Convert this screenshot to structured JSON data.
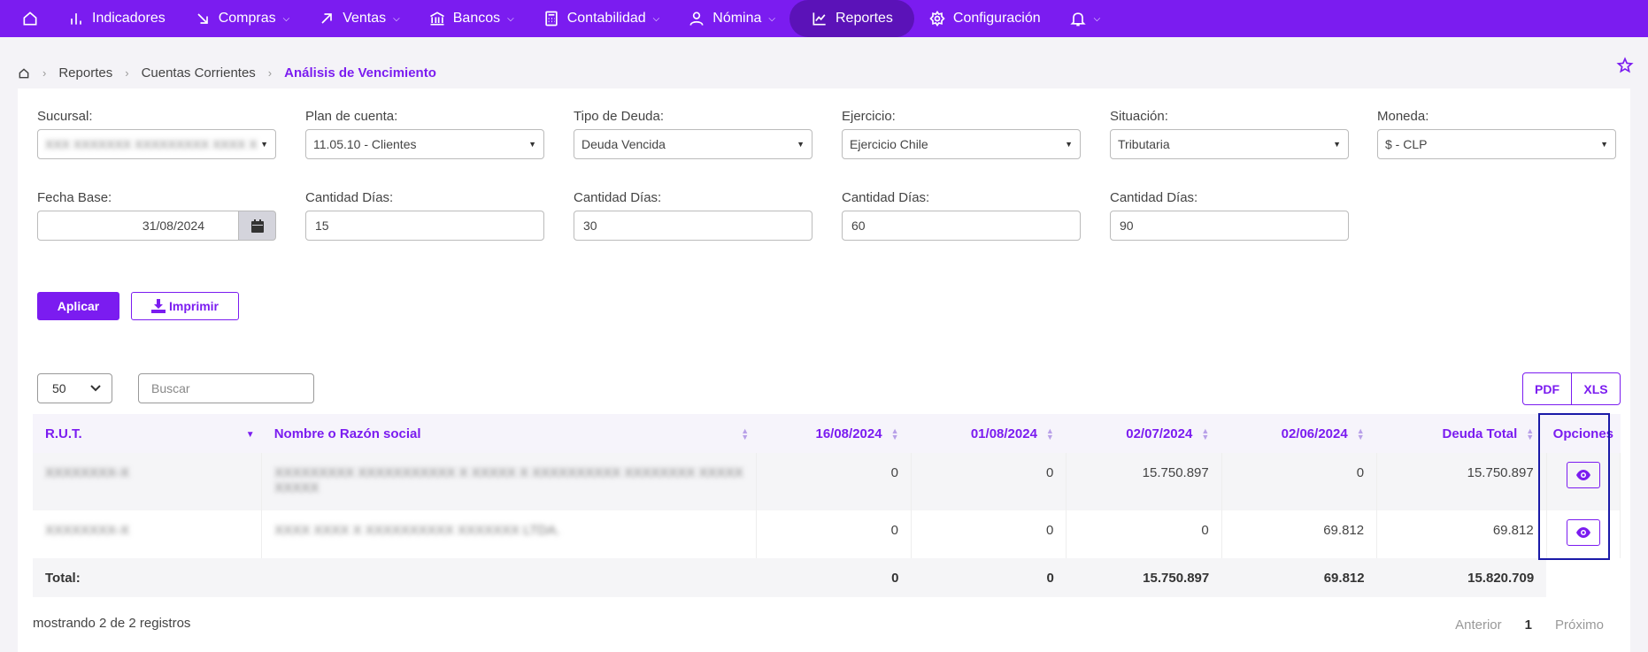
{
  "nav": {
    "items": [
      {
        "label": "",
        "icon": "home-icon"
      },
      {
        "label": "Indicadores",
        "icon": "bar-chart-icon"
      },
      {
        "label": "Compras",
        "icon": "arrow-down-right-icon"
      },
      {
        "label": "Ventas",
        "icon": "arrow-up-right-icon"
      },
      {
        "label": "Bancos",
        "icon": "bank-icon"
      },
      {
        "label": "Contabilidad",
        "icon": "calculator-icon"
      },
      {
        "label": "Nómina",
        "icon": "user-icon"
      },
      {
        "label": "Reportes",
        "icon": "line-chart-icon"
      },
      {
        "label": "Configuración",
        "icon": "gear-icon"
      },
      {
        "label": "",
        "icon": "bell-icon"
      }
    ]
  },
  "breadcrumb": {
    "item1": "Reportes",
    "item2": "Cuentas Corrientes",
    "current": "Análisis de Vencimiento"
  },
  "filters": {
    "sucursal": {
      "label": "Sucursal:",
      "value": "XXX XXXXXXX XXXXXXXXX XXXX X"
    },
    "plan": {
      "label": "Plan de cuenta:",
      "value": "11.05.10 - Clientes"
    },
    "tipo": {
      "label": "Tipo de Deuda:",
      "value": "Deuda Vencida"
    },
    "ejercicio": {
      "label": "Ejercicio:",
      "value": "Ejercicio Chile"
    },
    "situacion": {
      "label": "Situación:",
      "value": "Tributaria"
    },
    "moneda": {
      "label": "Moneda:",
      "value": "$ - CLP"
    },
    "fecha": {
      "label": "Fecha Base:",
      "value": "31/08/2024"
    },
    "dias1": {
      "label": "Cantidad Días:",
      "value": "15"
    },
    "dias2": {
      "label": "Cantidad Días:",
      "value": "30"
    },
    "dias3": {
      "label": "Cantidad Días:",
      "value": "60"
    },
    "dias4": {
      "label": "Cantidad Días:",
      "value": "90"
    }
  },
  "actions": {
    "apply": "Aplicar",
    "print": "Imprimir"
  },
  "table_controls": {
    "page_size": "50",
    "search_placeholder": "Buscar",
    "pdf": "PDF",
    "xls": "XLS"
  },
  "table": {
    "headers": [
      "R.U.T.",
      "Nombre o Razón social",
      "16/08/2024",
      "01/08/2024",
      "02/07/2024",
      "02/06/2024",
      "Deuda Total",
      "Opciones"
    ],
    "rows": [
      {
        "rut": "XXXXXXXX-X",
        "nombre": "XXXXXXXXX XXXXXXXXXXX X XXXXX X XXXXXXXXXX XXXXXXXX XXXXX",
        "nombre2": "XXXXX",
        "c1": "0",
        "c2": "0",
        "c3": "15.750.897",
        "c4": "0",
        "total": "15.750.897"
      },
      {
        "rut": "XXXXXXXX-X",
        "nombre": "XXXX XXXX X XXXXXXXXXX XXXXXXX LTDA.",
        "nombre2": "",
        "c1": "0",
        "c2": "0",
        "c3": "0",
        "c4": "69.812",
        "total": "69.812"
      }
    ],
    "totals": {
      "label": "Total:",
      "c1": "0",
      "c2": "0",
      "c3": "15.750.897",
      "c4": "69.812",
      "total": "15.820.709"
    }
  },
  "footer": {
    "showing": "mostrando 2 de 2 registros",
    "prev": "Anterior",
    "page": "1",
    "next": "Próximo"
  },
  "colors": {
    "accent": "#7b1cf0",
    "nav_active": "#5b12b8",
    "highlight": "#1a1aa8"
  }
}
